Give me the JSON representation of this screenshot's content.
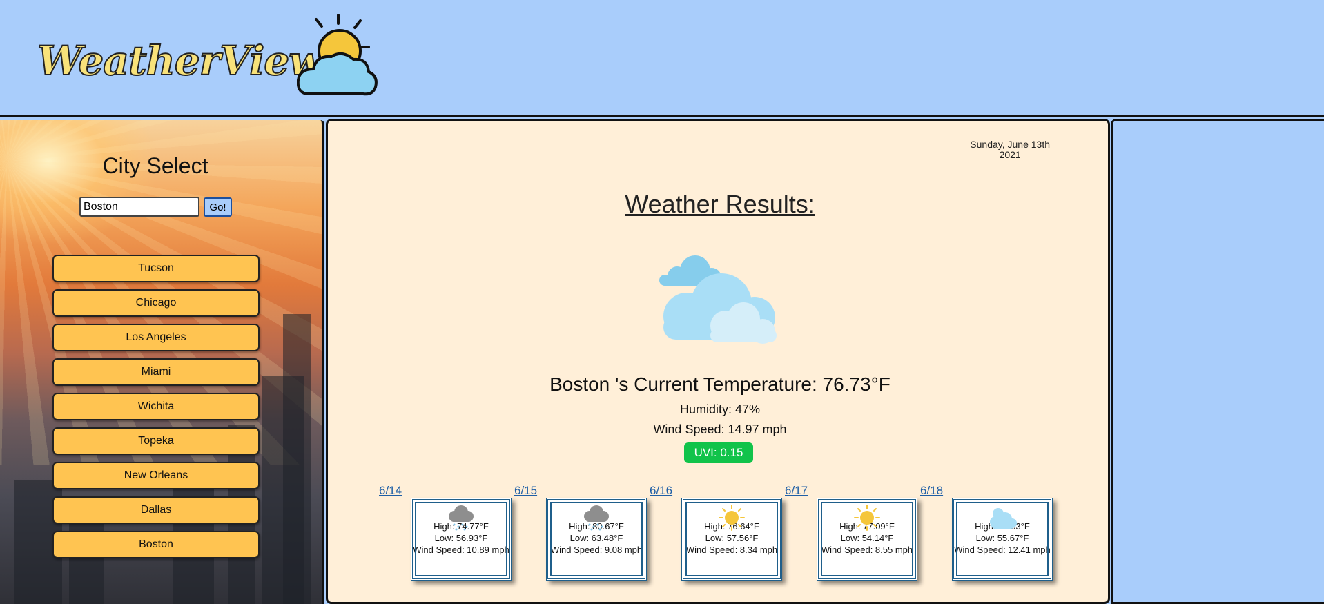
{
  "header": {
    "logo_text": "WeatherView"
  },
  "sidebar": {
    "title": "City Select",
    "search_value": "Boston",
    "go_label": "Go!",
    "cities": [
      "Tucson",
      "Chicago",
      "Los Angeles",
      "Miami",
      "Wichita",
      "Topeka",
      "New Orleans",
      "Dallas",
      "Boston"
    ]
  },
  "main": {
    "date_line1": "Sunday, June 13th",
    "date_line2": "2021",
    "results_title": "Weather Results:",
    "current_icon": "cloudy-icon",
    "current_temp": "Boston 's Current Temperature: 76.73°F",
    "humidity": "Humidity: 47%",
    "wind": "Wind Speed: 14.97 mph",
    "uvi": "UVI: 0.15",
    "uvi_color": "#11c34a"
  },
  "forecast": [
    {
      "date": "6/14",
      "icon": "rain-icon",
      "high": "High: 74.77°F",
      "low": "Low: 56.93°F",
      "wind": "Wind Speed: 10.89 mph"
    },
    {
      "date": "6/15",
      "icon": "rain-icon",
      "high": "High: 80.67°F",
      "low": "Low: 63.48°F",
      "wind": "Wind Speed: 9.08 mph"
    },
    {
      "date": "6/16",
      "icon": "sun-icon",
      "high": "High: 76.64°F",
      "low": "Low: 57.56°F",
      "wind": "Wind Speed: 8.34 mph"
    },
    {
      "date": "6/17",
      "icon": "sun-icon",
      "high": "High: 77.09°F",
      "low": "Low: 54.14°F",
      "wind": "Wind Speed: 8.55 mph"
    },
    {
      "date": "6/18",
      "icon": "cloud-icon",
      "high": "High: 82.53°F",
      "low": "Low: 55.67°F",
      "wind": "Wind Speed: 12.41 mph"
    }
  ],
  "colors": {
    "header_bg": "#a9cdfb",
    "main_bg": "#ffefd8",
    "city_button": "#ffc451",
    "link": "#1f5fa6"
  }
}
